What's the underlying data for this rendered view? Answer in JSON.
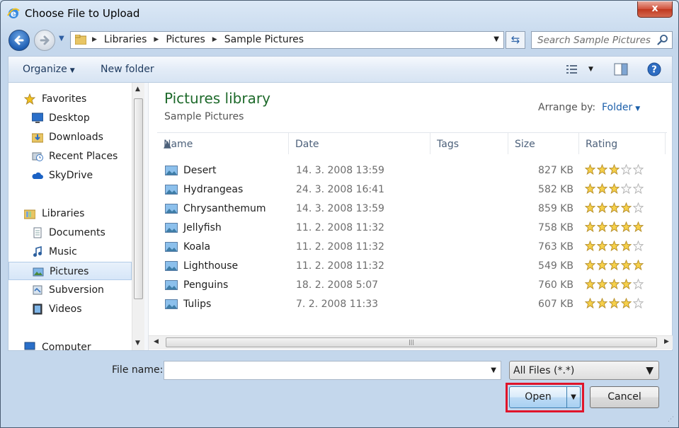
{
  "window": {
    "title": "Choose File to Upload",
    "close_glyph": "x"
  },
  "address": {
    "crumbs": [
      "Libraries",
      "Pictures",
      "Sample Pictures"
    ]
  },
  "search": {
    "placeholder": "Search Sample Pictures"
  },
  "toolbar": {
    "organize": "Organize",
    "new_folder": "New folder"
  },
  "navpane": {
    "items": [
      {
        "label": "Favorites",
        "icon": "star-icon"
      },
      {
        "label": "Desktop",
        "icon": "desktop-icon"
      },
      {
        "label": "Downloads",
        "icon": "downloads-folder-icon"
      },
      {
        "label": "Recent Places",
        "icon": "recent-places-icon"
      },
      {
        "label": "SkyDrive",
        "icon": "cloud-icon"
      },
      {
        "label": "Libraries",
        "icon": "libraries-icon"
      },
      {
        "label": "Documents",
        "icon": "documents-icon"
      },
      {
        "label": "Music",
        "icon": "music-icon"
      },
      {
        "label": "Pictures",
        "icon": "pictures-icon"
      },
      {
        "label": "Subversion",
        "icon": "subversion-icon"
      },
      {
        "label": "Videos",
        "icon": "videos-icon"
      },
      {
        "label": "Computer",
        "icon": "computer-icon"
      }
    ]
  },
  "library": {
    "title": "Pictures library",
    "subtitle": "Sample Pictures",
    "arrange_label": "Arrange by:",
    "arrange_value": "Folder"
  },
  "columns": {
    "name": "Name",
    "date": "Date",
    "tags": "Tags",
    "size": "Size",
    "rating": "Rating"
  },
  "files": [
    {
      "name": "Desert",
      "date": "14. 3. 2008 13:59",
      "size": "827 KB",
      "rating": 3
    },
    {
      "name": "Hydrangeas",
      "date": "24. 3. 2008 16:41",
      "size": "582 KB",
      "rating": 3
    },
    {
      "name": "Chrysanthemum",
      "date": "14. 3. 2008 13:59",
      "size": "859 KB",
      "rating": 4
    },
    {
      "name": "Jellyfish",
      "date": "11. 2. 2008 11:32",
      "size": "758 KB",
      "rating": 5
    },
    {
      "name": "Koala",
      "date": "11. 2. 2008 11:32",
      "size": "763 KB",
      "rating": 4
    },
    {
      "name": "Lighthouse",
      "date": "11. 2. 2008 11:32",
      "size": "549 KB",
      "rating": 5
    },
    {
      "name": "Penguins",
      "date": "18. 2. 2008 5:07",
      "size": "760 KB",
      "rating": 4
    },
    {
      "name": "Tulips",
      "date": "7. 2. 2008 11:33",
      "size": "607 KB",
      "rating": 4
    }
  ],
  "bottom": {
    "file_name_label": "File name:",
    "file_name_value": "",
    "file_type": "All Files (*.*)",
    "open": "Open",
    "cancel": "Cancel"
  },
  "colors": {
    "highlight": "#e0142a",
    "library_title": "#1e6a2b",
    "link": "#1b5faa"
  }
}
